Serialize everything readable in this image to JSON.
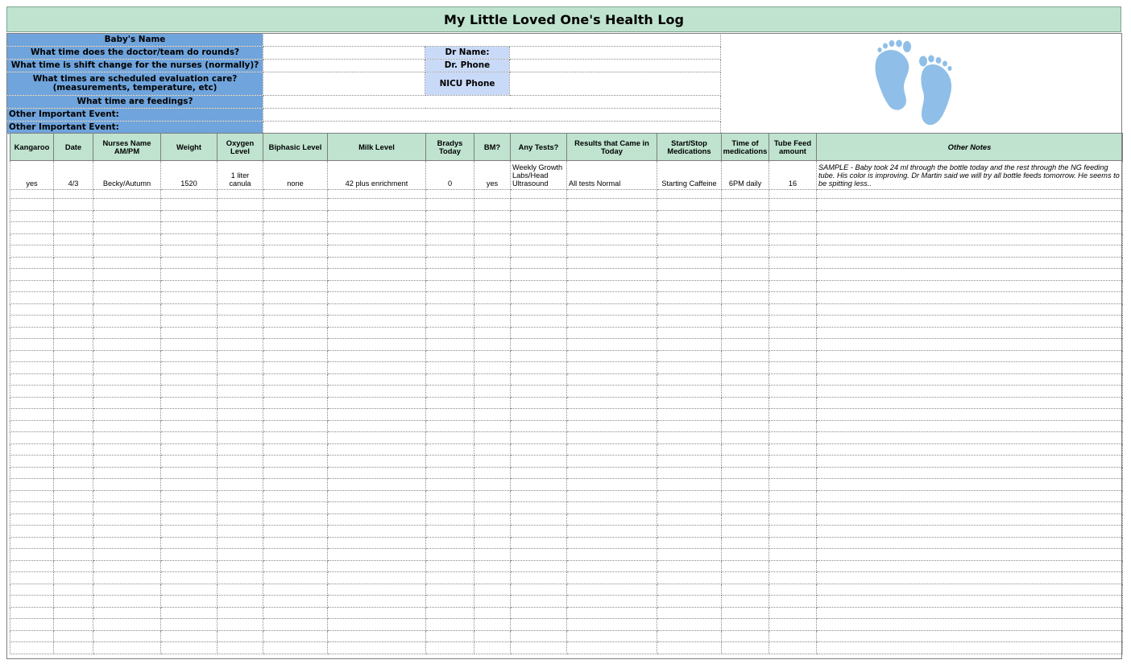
{
  "title": "My Little Loved One's Health Log",
  "info": {
    "baby_name_label": "Baby's Name",
    "rounds_label": "What time does the doctor/team do rounds?",
    "shift_label": "What time is shift change for the nurses (normally)?",
    "eval_label": "What times are scheduled evaluation care? (measurements, temperature, etc)",
    "feedings_label": "What time are feedings?",
    "event1_label": "Other Important Event:",
    "event2_label": "Other Important Event:",
    "dr_name_label": "Dr Name:",
    "dr_phone_label": "Dr. Phone",
    "nicu_phone_label": "NICU Phone"
  },
  "image": {
    "icon": "baby-feet-icon",
    "color": "#8fbfe8"
  },
  "columns": [
    "Kangaroo",
    "Date",
    "Nurses Name AM/PM",
    "Weight",
    "Oxygen Level",
    "Biphasic Level",
    "Milk Level",
    "Bradys Today",
    "BM?",
    "Any Tests?",
    "Results that Came in Today",
    "Start/Stop Medications",
    "Time of medications",
    "Tube Feed amount",
    "Other Notes"
  ],
  "sample_row": [
    "yes",
    "4/3",
    "Becky/Autumn",
    "1520",
    "1 liter canula",
    "none",
    "42 plus enrichment",
    "0",
    "yes",
    "Weekly Growth Labs/Head Ultrasound",
    "All tests Normal",
    "Starting Caffeine",
    "6PM daily",
    "16",
    "SAMPLE - Baby took 24 ml through the bottle today and the rest through the NG feeding tube. His color is improving. Dr Martin said we will try all bottle feeds tomorrow. He seems to be spitting less.."
  ],
  "colors": {
    "header_green": "#bfe3cf",
    "label_blue": "#6fa4dc",
    "light_blue": "#c9daf8"
  }
}
